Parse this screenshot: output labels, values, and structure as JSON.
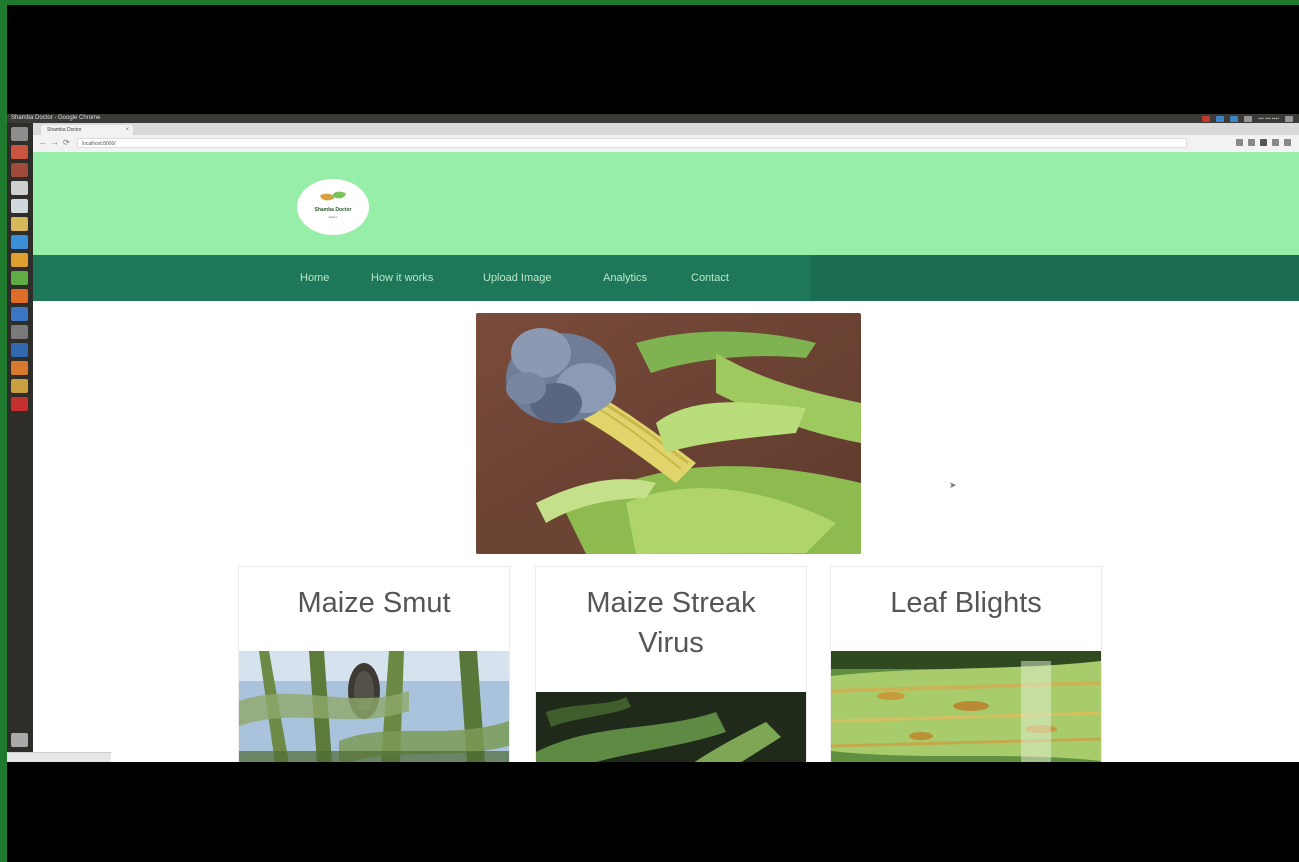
{
  "os": {
    "window_title": "Shamba Doctor - Google Chrome",
    "tray_text": "▪▪▪ ▪▪▪ ▪▪▪▪"
  },
  "browser": {
    "tab_title": "Shamba Doctor",
    "tab_close": "×",
    "address": "localhost:8000/",
    "back": "←",
    "forward": "→",
    "reload": "⟳"
  },
  "site": {
    "logo_name": "Shamba Doctor",
    "logo_tagline": "tagline",
    "nav": [
      "Home",
      "How it works",
      "Upload Image",
      "Analytics",
      "Contact"
    ]
  },
  "cards": [
    {
      "title": "Maize Smut"
    },
    {
      "title": "Maize Streak Virus"
    },
    {
      "title": "Leaf Blights"
    }
  ],
  "colors": {
    "header_bg": "#97eea9",
    "nav_bg": "#1f775a",
    "border_green": "#1e7a2c"
  },
  "icons": [
    "cursor-arrow-icon",
    "back-icon",
    "forward-icon",
    "reload-icon"
  ]
}
